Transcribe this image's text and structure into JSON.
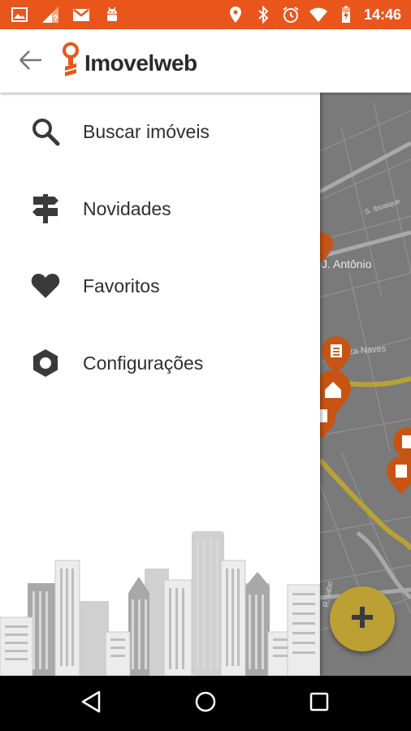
{
  "status_bar": {
    "time": "14:46",
    "left_icons": [
      "image-icon",
      "signal-unknown-icon",
      "gmail-icon",
      "android-icon"
    ],
    "right_icons": [
      "location-icon",
      "bluetooth-icon",
      "alarm-icon",
      "wifi-icon",
      "battery-charging-icon"
    ],
    "color": "#e8561b"
  },
  "app_bar": {
    "title": "Imovelweb",
    "back_icon": "arrow-back-icon",
    "logo_icon": "key-pin-logo-icon"
  },
  "drawer": {
    "items": [
      {
        "label": "Buscar imóveis",
        "icon": "search-icon"
      },
      {
        "label": "Novidades",
        "icon": "signpost-icon"
      },
      {
        "label": "Favoritos",
        "icon": "heart-icon"
      },
      {
        "label": "Configurações",
        "icon": "settings-icon"
      }
    ]
  },
  "map": {
    "labels": [
      "S. Iboaique",
      "J. Antônio",
      "n. Souza Naves",
      "R. Iabo"
    ],
    "marker_color": "#c85414"
  },
  "fab": {
    "icon": "plus-icon",
    "color": "#bca034"
  },
  "nav_bar": {
    "buttons": [
      "back-triangle-icon",
      "home-circle-icon",
      "recents-square-icon"
    ]
  }
}
